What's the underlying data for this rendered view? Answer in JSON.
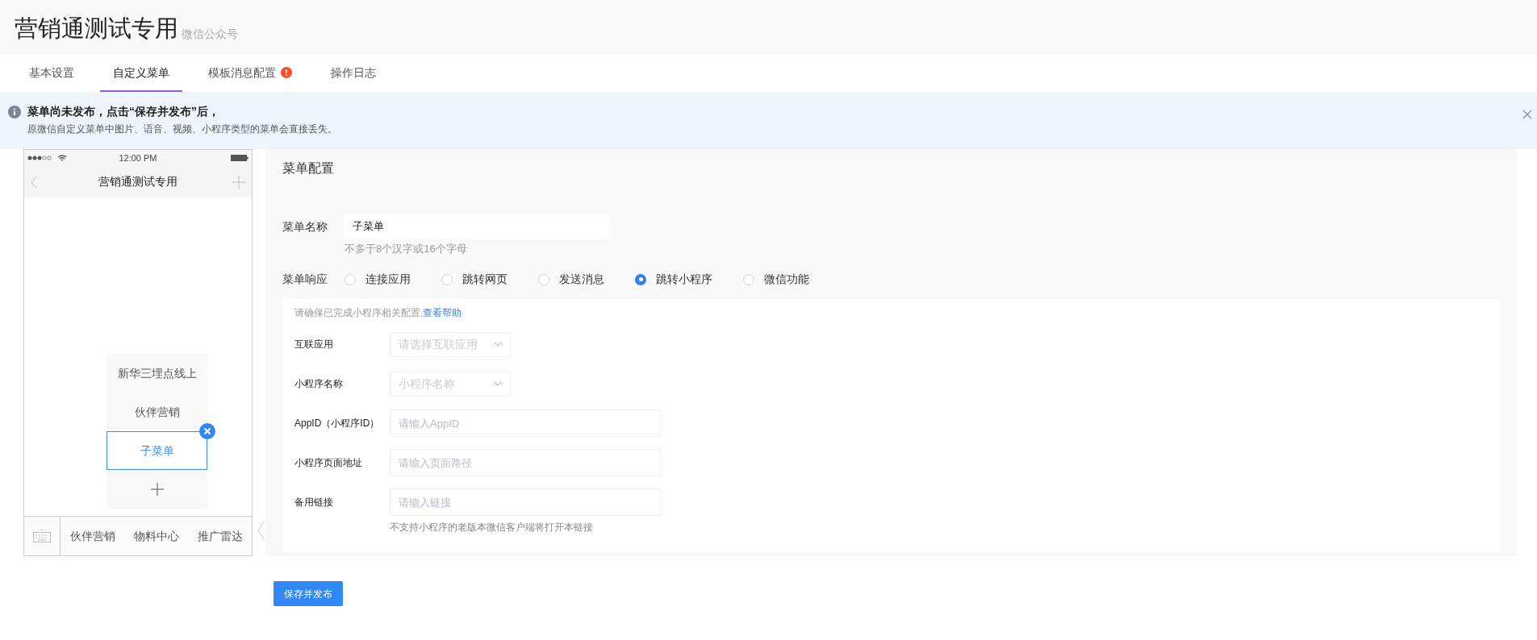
{
  "header": {
    "title": "营销通测试专用",
    "subtitle": "微信公众号"
  },
  "tabs": [
    {
      "label": "基本设置",
      "selected": false
    },
    {
      "label": "自定义菜单",
      "selected": true
    },
    {
      "label": "模板消息配置",
      "selected": false,
      "badge": "!"
    },
    {
      "label": "操作日志",
      "selected": false
    }
  ],
  "notice": {
    "title": "菜单尚未发布，点击“保存并发布”后，",
    "body": "原微信自定义菜单中图片、语音、视频、小程序类型的菜单会直接丢失。"
  },
  "phone": {
    "time": "12:00 PM",
    "title": "营销通测试专用",
    "submenu": [
      {
        "label": "新华三埋点线上",
        "selected": false
      },
      {
        "label": "伙伴营销",
        "selected": false
      },
      {
        "label": "子菜单",
        "selected": true
      }
    ],
    "menu": [
      "伙伴营销",
      "物料中心",
      "推广雷达"
    ]
  },
  "config": {
    "title": "菜单配置",
    "name_label": "菜单名称",
    "name_value": "子菜单",
    "name_hint": "不多于8个汉字或16个字母",
    "response_label": "菜单响应",
    "options": [
      {
        "label": "连接应用",
        "selected": false
      },
      {
        "label": "跳转网页",
        "selected": false
      },
      {
        "label": "发送消息",
        "selected": false
      },
      {
        "label": "跳转小程序",
        "selected": true
      },
      {
        "label": "微信功能",
        "selected": false
      }
    ],
    "help_text": "请确保已完成小程序相关配置,",
    "help_link": "查看帮助",
    "fields": [
      {
        "kind": "select",
        "label": "互联应用",
        "placeholder": "请选择互联应用"
      },
      {
        "kind": "select",
        "label": "小程序名称",
        "placeholder": "小程序名称"
      },
      {
        "kind": "input",
        "label": "AppID（小程序ID）",
        "placeholder": "请输入AppID"
      },
      {
        "kind": "input",
        "label": "小程序页面地址",
        "placeholder": "请输入页面路径"
      },
      {
        "kind": "input",
        "label": "备用链接",
        "placeholder": "请输入链接"
      }
    ],
    "fields_hint": "不支持小程序的老版本微信客户端将打开本链接"
  },
  "save_button": "保存并发布"
}
